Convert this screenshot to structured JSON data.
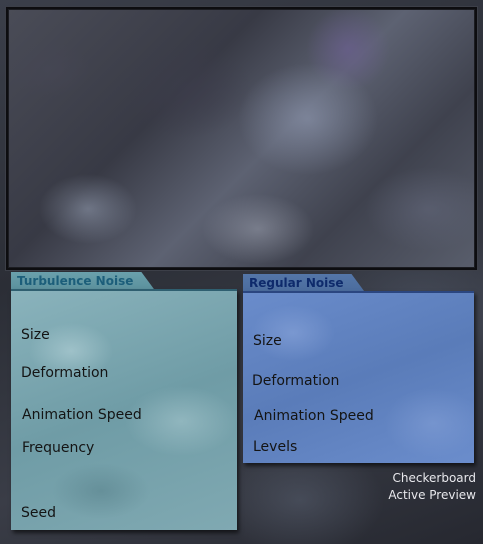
{
  "turbulence": {
    "title": "Turbulence Noise",
    "labels": [
      "Size",
      "Deformation",
      "Animation Speed",
      "Frequency",
      "Seed"
    ]
  },
  "regular": {
    "title": "Regular Noise",
    "labels": [
      "Size",
      "Deformation",
      "Animation Speed",
      "Levels"
    ]
  },
  "options": {
    "checkerboard": "Checkerboard",
    "active_preview": "Active Preview"
  }
}
